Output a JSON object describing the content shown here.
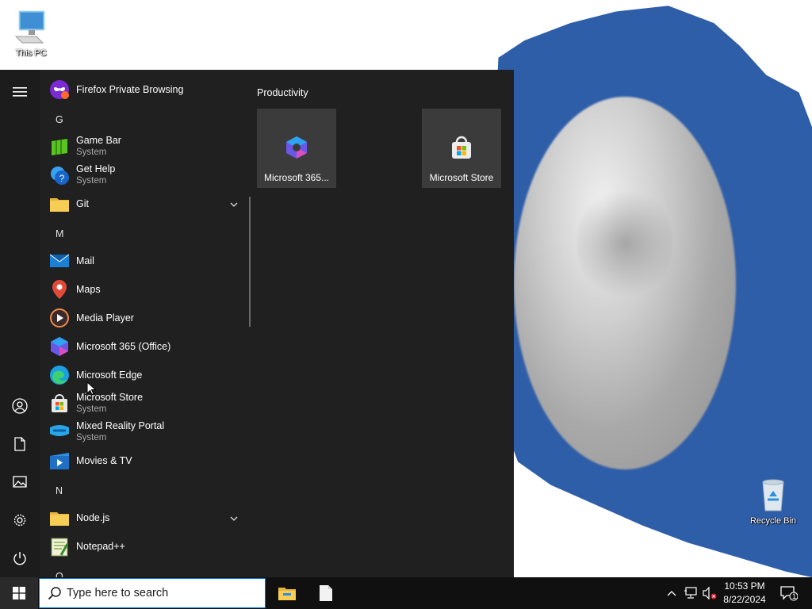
{
  "desktop": {
    "icons": [
      {
        "label": "This PC"
      },
      {
        "label": "Recycle Bin"
      }
    ]
  },
  "start_menu": {
    "apps": {
      "firefox_private": {
        "label": "Firefox Private Browsing",
        "icon": "firefox-private-icon"
      },
      "letter_g": "G",
      "game_bar": {
        "label": "Game Bar",
        "sub": "System",
        "icon": "game-bar-icon"
      },
      "get_help": {
        "label": "Get Help",
        "sub": "System",
        "icon": "help-icon"
      },
      "git": {
        "label": "Git",
        "icon": "folder-icon"
      },
      "letter_m": "M",
      "mail": {
        "label": "Mail",
        "icon": "mail-icon"
      },
      "maps": {
        "label": "Maps",
        "icon": "maps-icon"
      },
      "media_player": {
        "label": "Media Player",
        "icon": "media-player-icon"
      },
      "m365": {
        "label": "Microsoft 365 (Office)",
        "icon": "microsoft-365-icon"
      },
      "edge": {
        "label": "Microsoft Edge",
        "icon": "edge-icon"
      },
      "store": {
        "label": "Microsoft Store",
        "sub": "System",
        "icon": "store-icon"
      },
      "mixed_reality": {
        "label": "Mixed Reality Portal",
        "sub": "System",
        "icon": "mixed-reality-icon"
      },
      "movies": {
        "label": "Movies & TV",
        "icon": "movies-icon"
      },
      "letter_n": "N",
      "nodejs": {
        "label": "Node.js",
        "icon": "folder-icon"
      },
      "notepadpp": {
        "label": "Notepad++",
        "icon": "notepad-plus-plus-icon"
      },
      "letter_o": "O"
    },
    "tiles": {
      "group_title": "Productivity",
      "items": [
        {
          "label": "Microsoft 365...",
          "icon": "microsoft-365-icon"
        },
        {
          "label": "Microsoft Store",
          "icon": "store-icon"
        }
      ]
    }
  },
  "taskbar": {
    "search_placeholder": "Type here to search",
    "clock_time": "10:53 PM",
    "clock_date": "8/22/2024",
    "notification_count": "1"
  }
}
